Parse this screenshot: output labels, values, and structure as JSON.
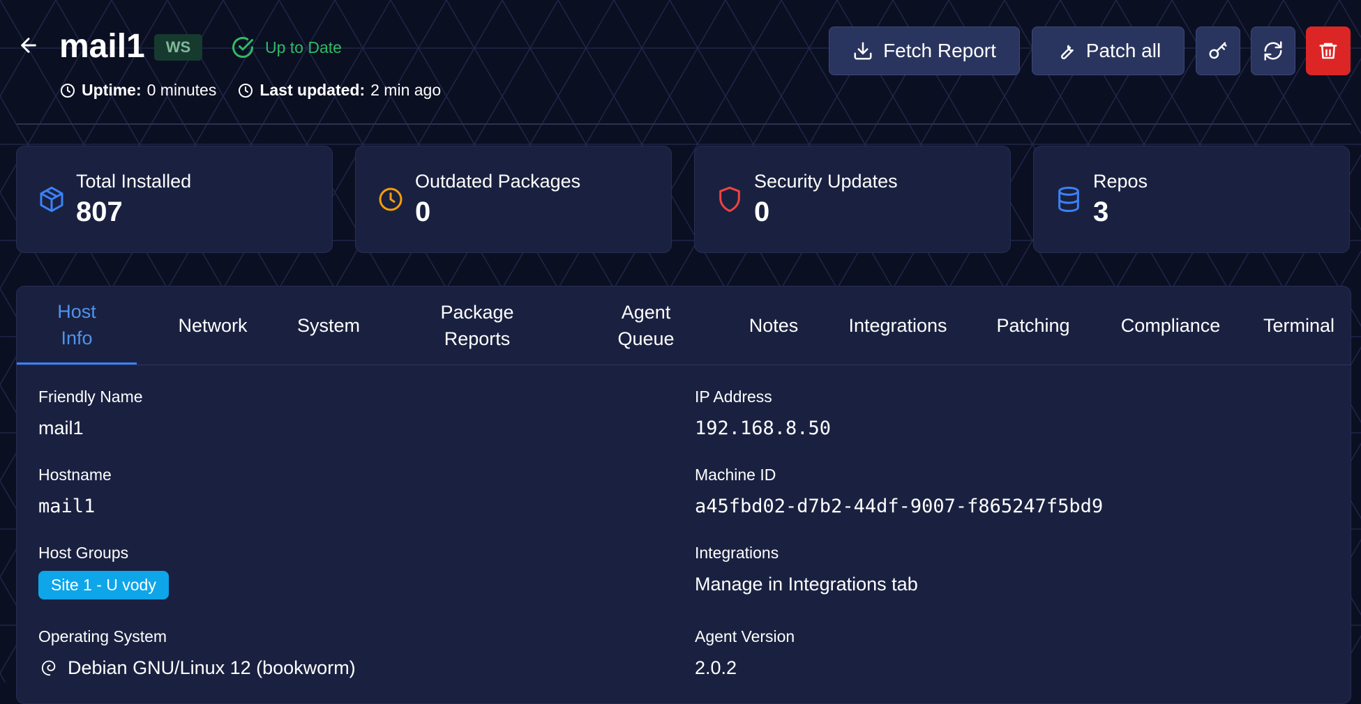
{
  "host": {
    "name": "mail1",
    "badge": "WS",
    "status": "Up to Date",
    "uptime_label": "Uptime:",
    "uptime_value": "0 minutes",
    "updated_label": "Last updated:",
    "updated_value": "2 min ago"
  },
  "actions": {
    "fetch_report": "Fetch Report",
    "patch_all": "Patch all"
  },
  "stats": [
    {
      "label": "Total Installed",
      "value": "807",
      "icon": "package-icon",
      "color": "#3b82f6"
    },
    {
      "label": "Outdated Packages",
      "value": "0",
      "icon": "clock-icon",
      "color": "#f59e0b"
    },
    {
      "label": "Security Updates",
      "value": "0",
      "icon": "shield-icon",
      "color": "#ef4444"
    },
    {
      "label": "Repos",
      "value": "3",
      "icon": "database-icon",
      "color": "#3b82f6"
    }
  ],
  "tabs": {
    "host_info_1": "Host",
    "host_info_2": "Info",
    "network": "Network",
    "system": "System",
    "package_reports_1": "Package",
    "package_reports_2": "Reports",
    "agent_queue_1": "Agent",
    "agent_queue_2": "Queue",
    "notes": "Notes",
    "integrations": "Integrations",
    "patching": "Patching",
    "compliance": "Compliance",
    "terminal": "Terminal"
  },
  "details": {
    "friendly_name_label": "Friendly Name",
    "friendly_name": "mail1",
    "hostname_label": "Hostname",
    "hostname": "mail1",
    "host_groups_label": "Host Groups",
    "host_group": "Site 1 - U vody",
    "os_label": "Operating System",
    "os": "Debian GNU/Linux 12 (bookworm)",
    "ip_label": "IP Address",
    "ip": "192.168.8.50",
    "machine_id_label": "Machine ID",
    "machine_id": "a45fbd02-d7b2-44df-9007-f865247f5bd9",
    "integrations_label": "Integrations",
    "integrations_link": "Manage in Integrations tab",
    "agent_version_label": "Agent Version",
    "agent_version": "2.0.2"
  },
  "colors": {
    "accent": "#3b82f6",
    "success": "#2fbb64",
    "danger": "#dc2626",
    "background": "#0b0f22",
    "card": "#1a2140"
  }
}
